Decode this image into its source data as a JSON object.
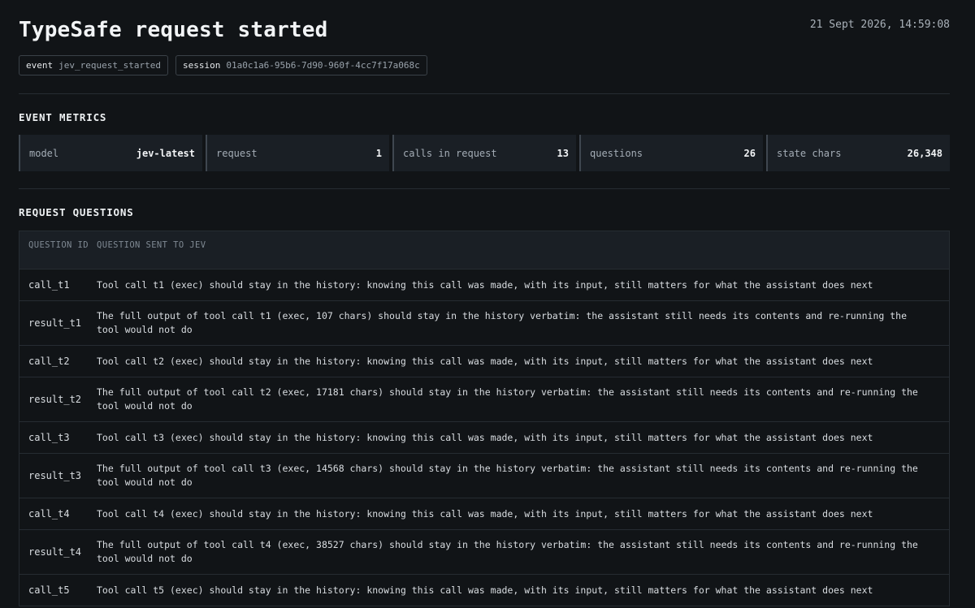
{
  "header": {
    "title": "TypeSafe request started",
    "timestamp": "21 Sept 2026, 14:59:08",
    "chips": [
      {
        "key": "event",
        "value": "jev_request_started"
      },
      {
        "key": "session",
        "value": "01a0c1a6-95b6-7d90-960f-4cc7f17a068c"
      }
    ]
  },
  "metrics_section": {
    "title": "EVENT METRICS",
    "metrics": [
      {
        "label": "model",
        "value": "jev-latest"
      },
      {
        "label": "request",
        "value": "1"
      },
      {
        "label": "calls in request",
        "value": "13"
      },
      {
        "label": "questions",
        "value": "26"
      },
      {
        "label": "state chars",
        "value": "26,348"
      }
    ]
  },
  "questions_section": {
    "title": "REQUEST QUESTIONS",
    "columns": [
      "QUESTION ID",
      "QUESTION SENT TO JEV"
    ],
    "rows": [
      {
        "id": "call_t1",
        "question": "Tool call t1 (exec) should stay in the history: knowing this call was made, with its input, still matters for what the assistant does next"
      },
      {
        "id": "result_t1",
        "question": "The full output of tool call t1 (exec, 107 chars) should stay in the history verbatim: the assistant still needs its contents and re-running the tool would not do"
      },
      {
        "id": "call_t2",
        "question": "Tool call t2 (exec) should stay in the history: knowing this call was made, with its input, still matters for what the assistant does next"
      },
      {
        "id": "result_t2",
        "question": "The full output of tool call t2 (exec, 17181 chars) should stay in the history verbatim: the assistant still needs its contents and re-running the tool would not do"
      },
      {
        "id": "call_t3",
        "question": "Tool call t3 (exec) should stay in the history: knowing this call was made, with its input, still matters for what the assistant does next"
      },
      {
        "id": "result_t3",
        "question": "The full output of tool call t3 (exec, 14568 chars) should stay in the history verbatim: the assistant still needs its contents and re-running the tool would not do"
      },
      {
        "id": "call_t4",
        "question": "Tool call t4 (exec) should stay in the history: knowing this call was made, with its input, still matters for what the assistant does next"
      },
      {
        "id": "result_t4",
        "question": "The full output of tool call t4 (exec, 38527 chars) should stay in the history verbatim: the assistant still needs its contents and re-running the tool would not do"
      },
      {
        "id": "call_t5",
        "question": "Tool call t5 (exec) should stay in the history: knowing this call was made, with its input, still matters for what the assistant does next"
      }
    ]
  }
}
